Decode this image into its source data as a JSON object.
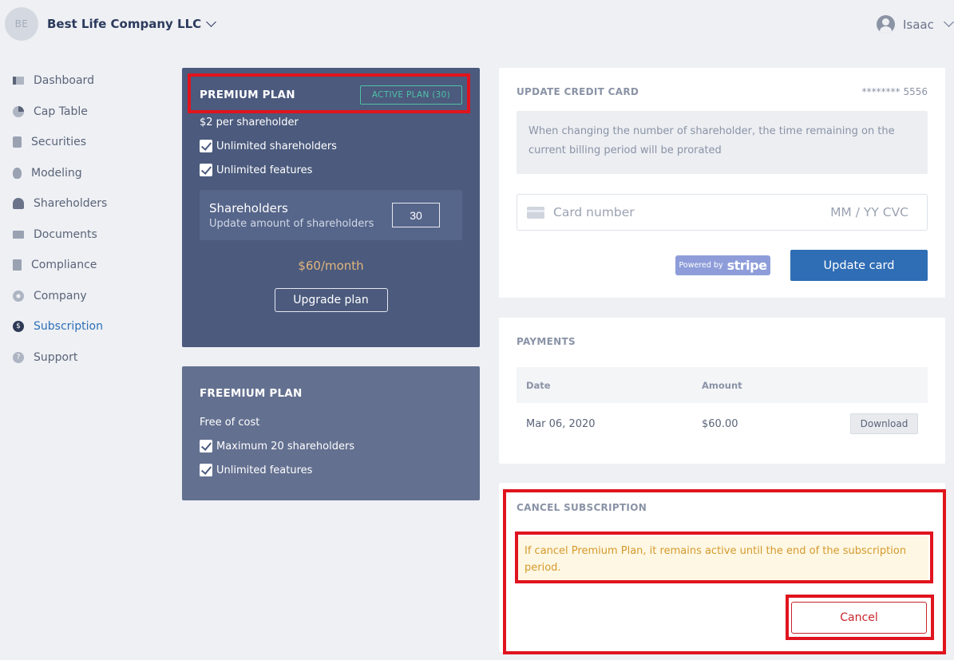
{
  "header": {
    "company_initials": "BE",
    "company_name": "Best Life Company LLC",
    "user_name": "Isaac"
  },
  "sidebar": {
    "items": [
      {
        "label": "Dashboard",
        "icon": "dashboard-icon"
      },
      {
        "label": "Cap Table",
        "icon": "pie-chart-icon"
      },
      {
        "label": "Securities",
        "icon": "clipboard-icon"
      },
      {
        "label": "Modeling",
        "icon": "lightbulb-icon"
      },
      {
        "label": "Shareholders",
        "icon": "user-icon"
      },
      {
        "label": "Documents",
        "icon": "folder-icon"
      },
      {
        "label": "Compliance",
        "icon": "document-check-icon"
      },
      {
        "label": "Company",
        "icon": "gear-icon"
      },
      {
        "label": "Subscription",
        "icon": "dollar-icon",
        "active": true
      },
      {
        "label": "Support",
        "icon": "help-icon"
      }
    ],
    "active_color": "#2d6fb6"
  },
  "premium": {
    "title": "PREMIUM PLAN",
    "badge": "ACTIVE PLAN (30)",
    "price_line": "$2 per shareholder",
    "features": [
      "Unlimited shareholders",
      "Unlimited features"
    ],
    "shareholders_title": "Shareholders",
    "shareholders_sub": "Update amount of shareholders",
    "shareholders_value": "30",
    "monthly_price": "$60/month",
    "upgrade_label": "Upgrade plan"
  },
  "freemium": {
    "title": "FREEMIUM PLAN",
    "price_line": "Free of cost",
    "features": [
      "Maximum 20 shareholders",
      "Unlimited features"
    ]
  },
  "credit_card": {
    "title": "UPDATE CREDIT CARD",
    "masked_number": "******** 5556",
    "info": "When changing the number of shareholder, the time remaining on the current billing period will be prorated",
    "card_placeholder": "Card number",
    "expiry_cvc_placeholder": "MM / YY  CVC",
    "powered_by": "Powered by",
    "stripe": "stripe",
    "update_label": "Update card"
  },
  "payments": {
    "title": "PAYMENTS",
    "columns": [
      "Date",
      "Amount"
    ],
    "rows": [
      {
        "date": "Mar 06, 2020",
        "amount": "$60.00",
        "action": "Download"
      }
    ]
  },
  "cancel": {
    "title": "CANCEL SUBSCRIPTION",
    "warning": "If cancel Premium Plan, it remains active until the end of the subscription period.",
    "cancel_label": "Cancel"
  },
  "colors": {
    "premium_bg": "#4b5a7d",
    "freemium_bg": "#637090",
    "accent_blue": "#2f6db5",
    "highlight_red": "#e0141e"
  }
}
